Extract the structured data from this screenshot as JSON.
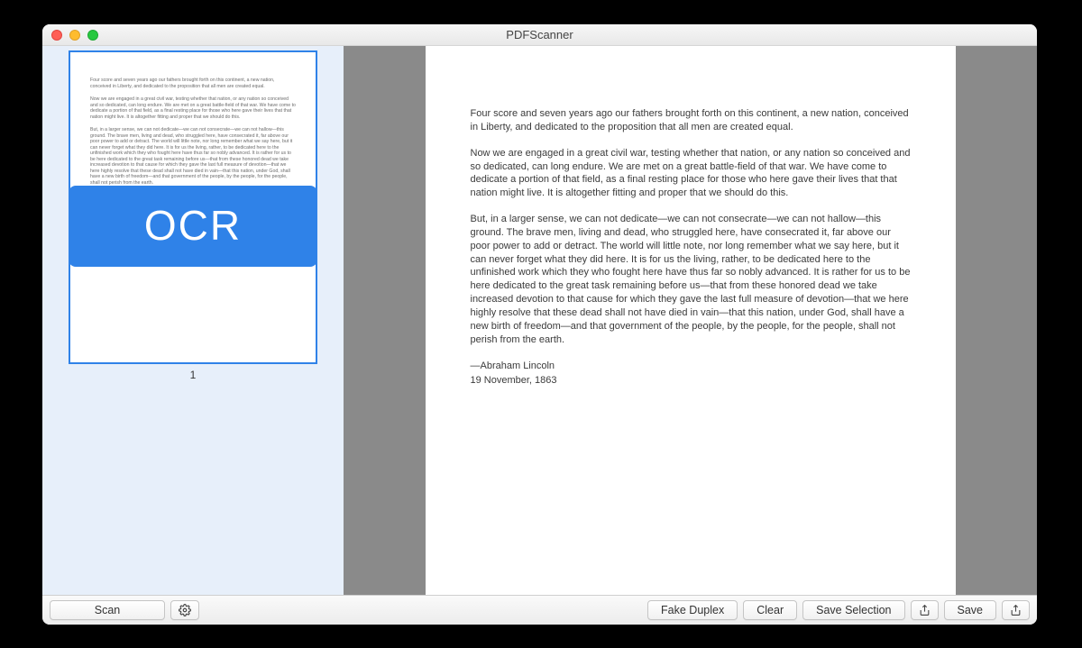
{
  "window": {
    "title": "PDFScanner"
  },
  "sidebar": {
    "thumbnail": {
      "page_number": "1",
      "overlay_label": "OCR"
    }
  },
  "document": {
    "paragraphs": [
      "Four score and seven years ago our fathers brought forth on this continent, a new nation, conceived in Liberty, and dedicated to the proposition that all men are created equal.",
      "Now we are engaged in a great civil war, testing whether that nation, or any nation so conceived and so dedicated, can long endure. We are met on a great battle-field of that war. We have come to dedicate a portion of that field, as a final resting place for those who here gave their lives that that nation might live. It is altogether fitting and proper that we should do this.",
      "But, in a larger sense, we can not dedicate—we can not consecrate—we can not hallow—this ground. The brave men, living and dead, who struggled here, have consecrated it, far above our poor power to add or detract. The world will little note, nor long remember what we say here, but it can never forget what they did here. It is for us the living, rather, to be dedicated here to the unfinished work which they who fought here have thus far so nobly advanced. It is rather for us to be here dedicated to the great task remaining before us—that from these honored dead we take increased devotion to that cause for which they gave the last full measure of devotion—that we here highly resolve that these dead shall not have died in vain—that this nation, under God, shall have a new birth of freedom—and that government of the people, by the people, for the people, shall not perish from the earth."
    ],
    "signoff_author": "—Abraham Lincoln",
    "signoff_date": "19 November, 1863"
  },
  "toolbar": {
    "scan_label": "Scan",
    "settings_icon": "gear-icon",
    "fake_duplex_label": "Fake Duplex",
    "clear_label": "Clear",
    "save_selection_label": "Save Selection",
    "share_selection_icon": "share-icon",
    "save_label": "Save",
    "share_icon": "share-icon"
  },
  "colors": {
    "selection_blue": "#2f82e8",
    "preview_bg": "#8a8a8a",
    "sidebar_bg": "#e7effa"
  }
}
